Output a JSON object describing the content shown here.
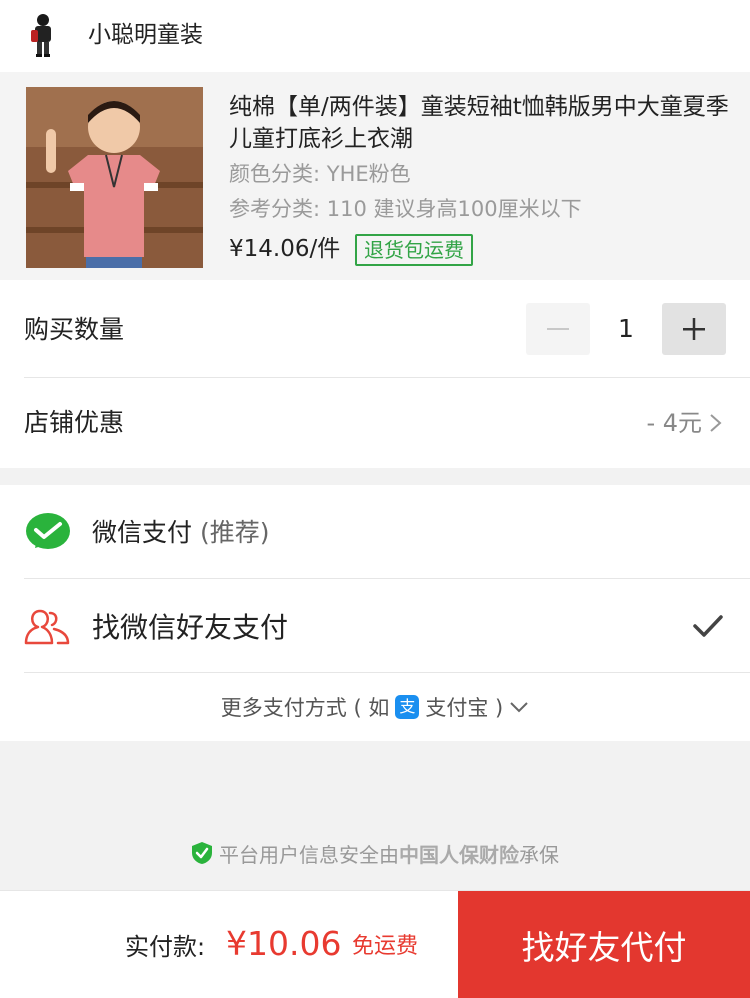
{
  "shop": {
    "name": "小聪明童装",
    "avatar_icon": "boy-figure-icon"
  },
  "product": {
    "title": "纯棉【单/两件装】童装短袖t恤韩版男中大童夏季儿童打底衫上衣潮",
    "spec_color": "颜色分类: YHE粉色",
    "spec_size": "参考分类: 110 建议身高100厘米以下",
    "price": "¥14.06/件",
    "badge": "退货包运费"
  },
  "quantity": {
    "label": "购买数量",
    "minus": "−",
    "value": "1",
    "plus": "+"
  },
  "discount": {
    "label": "店铺优惠",
    "value": "- 4元"
  },
  "payment": {
    "wechat_label": "微信支付",
    "wechat_sub": "(推荐)",
    "friend_label": "找微信好友支付",
    "more_prefix": "更多支付方式 ( 如",
    "alipay_glyph": "支",
    "alipay_label": "支付宝 )"
  },
  "security": {
    "prefix": "平台用户信息安全由",
    "insurer": "中国人保财险",
    "suffix": "承保"
  },
  "footer": {
    "pay_label": "实付款:",
    "amount": "¥10.06",
    "free_shipping": "免运费",
    "cta": "找好友代付"
  },
  "colors": {
    "accent": "#e3372f",
    "wechat_green": "#2ab33c",
    "badge_green": "#32a446",
    "alipay_blue": "#1a8ff0"
  }
}
